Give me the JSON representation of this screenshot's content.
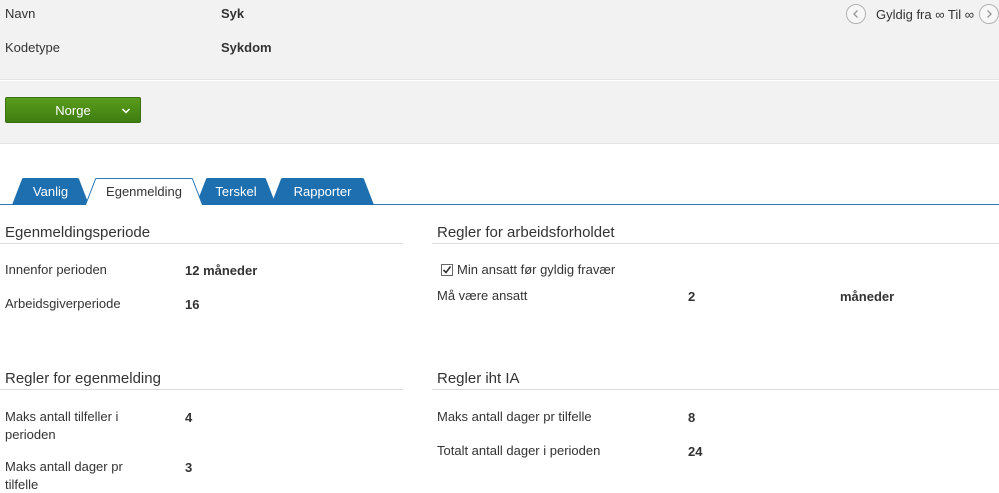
{
  "header": {
    "fields": [
      {
        "label": "Navn",
        "value": "Syk"
      },
      {
        "label": "Kodetype",
        "value": "Sykdom"
      }
    ],
    "validity": {
      "text": "Gyldig fra ∞ Til ∞",
      "prev_icon": "chevron-left-icon",
      "next_icon": "chevron-right-icon"
    }
  },
  "country_selector": {
    "label": "Norge",
    "icon": "chevron-down-icon",
    "color": "#4a8a16"
  },
  "tabs": [
    {
      "label": "Vanlig",
      "active": false
    },
    {
      "label": "Egenmelding",
      "active": true
    },
    {
      "label": "Terskel",
      "active": false
    },
    {
      "label": "Rapporter",
      "active": false
    }
  ],
  "accent_color": "#1e6fb0",
  "sections": {
    "egenmeldingsperiode": {
      "title": "Egenmeldingsperiode",
      "rows": [
        {
          "label": "Innenfor perioden",
          "value": "12 måneder"
        },
        {
          "label": "Arbeidsgiverperiode",
          "value": "16"
        }
      ]
    },
    "arbeidsforholdet": {
      "title": "Regler for arbeidsforholdet",
      "checkbox": {
        "label": "Min ansatt før gyldig fravær",
        "checked": true
      },
      "rows": [
        {
          "label": "Må være ansatt",
          "value": "2",
          "unit": "måneder"
        }
      ]
    },
    "egenmelding": {
      "title": "Regler for egenmelding",
      "rows": [
        {
          "label": "Maks antall tilfeller i perioden",
          "value": "4"
        },
        {
          "label": "Maks antall dager pr tilfelle",
          "value": "3"
        }
      ]
    },
    "ia": {
      "title": "Regler iht IA",
      "rows": [
        {
          "label": "Maks antall dager pr tilfelle",
          "value": "8"
        },
        {
          "label": "Totalt antall dager i perioden",
          "value": "24"
        }
      ]
    }
  }
}
